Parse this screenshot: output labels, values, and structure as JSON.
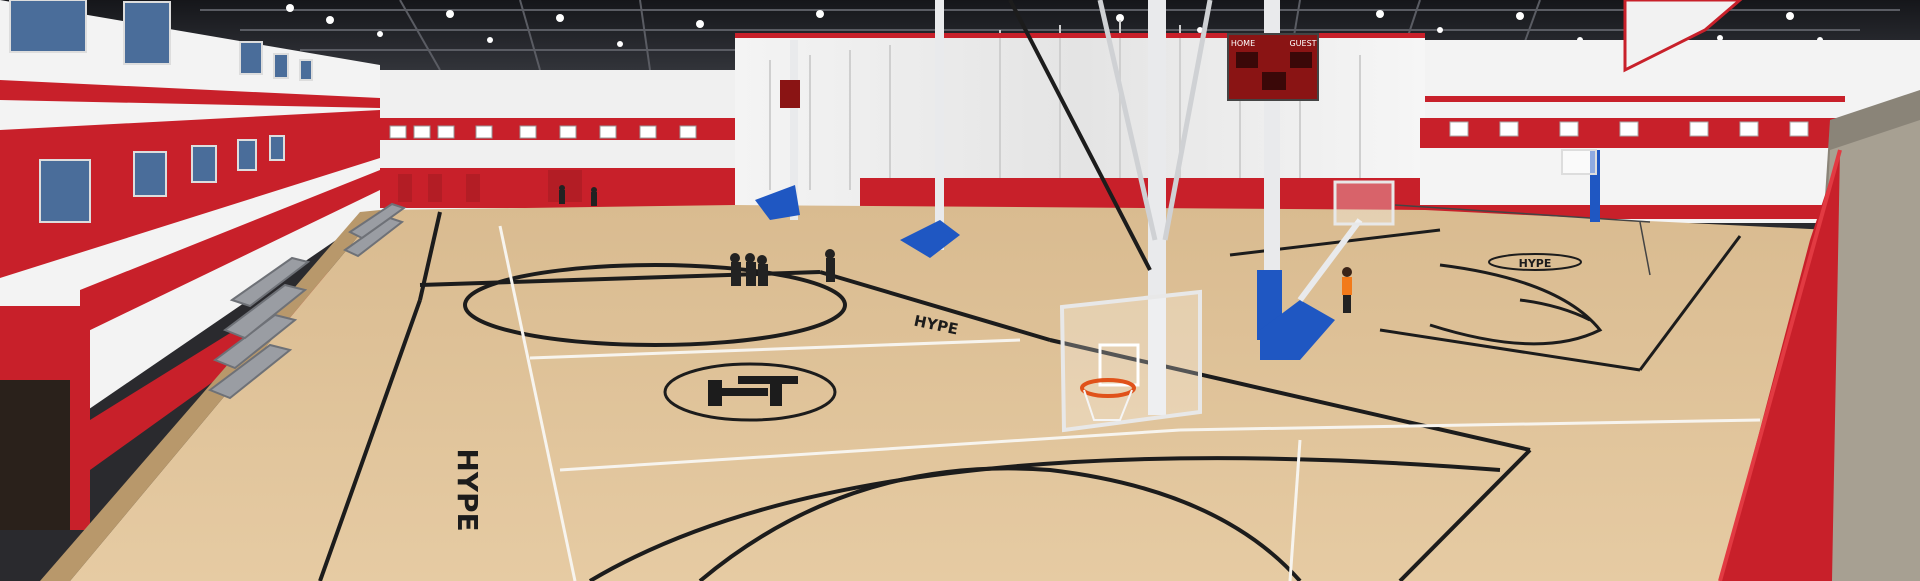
{
  "scene": {
    "description_free": true,
    "colors": {
      "floor": "#e0c39a",
      "floor_dark": "#cfae82",
      "wall_white": "#f2f2f2",
      "wall_red": "#c8202a",
      "ceiling": "#1e1f24",
      "stands": "#8e9196",
      "hoop_blue": "#1f57c2",
      "line_black": "#1c1c1c",
      "line_white": "#f7f4ee",
      "scoreboard": "#8a1414"
    },
    "court_texts": {
      "brand_left": "HYPE",
      "brand_mid": "HYPE",
      "brand_right": "HYPE"
    },
    "scoreboard": {
      "home_label": "HOME",
      "guest_label": "GUEST"
    },
    "icons": [
      "basketball-hoop-icon",
      "scoreboard-icon",
      "person-icon",
      "center-court-logo-icon"
    ]
  }
}
